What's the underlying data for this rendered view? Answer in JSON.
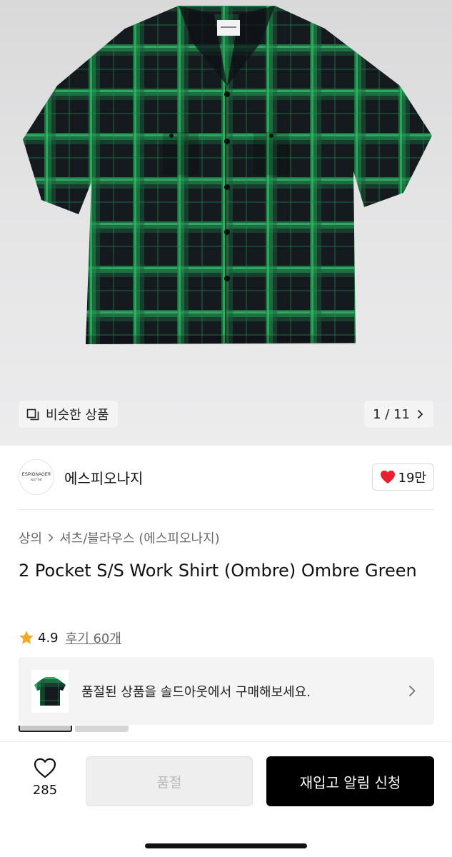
{
  "gallery": {
    "similar_label": "비슷한 상품",
    "counter": "1 / 11"
  },
  "brand": {
    "logo_line1": "ESPIONAGE®",
    "logo_line2": "N37°56'",
    "name": "에스피오나지",
    "like_count": "19만"
  },
  "breadcrumb": {
    "category": "상의",
    "subcategory": "셔츠/블라우스 (에스피오나지)"
  },
  "product": {
    "title": "2 Pocket S/S Work Shirt (Ombre) Ombre Green",
    "rating": "4.9",
    "reviews": "후기 60개"
  },
  "soldout_banner": {
    "text": "품절된 상품을 솔드아웃에서 구매해보세요."
  },
  "bottom_bar": {
    "wish_count": "285",
    "soldout_label": "품절",
    "restock_label": "재입고 알림 신청"
  },
  "colors": {
    "shirt_dark": "#141a1e",
    "shirt_green": "#1f8a4c",
    "heart": "#e8202c",
    "star": "#f5a623",
    "primary_button": "#000000"
  }
}
